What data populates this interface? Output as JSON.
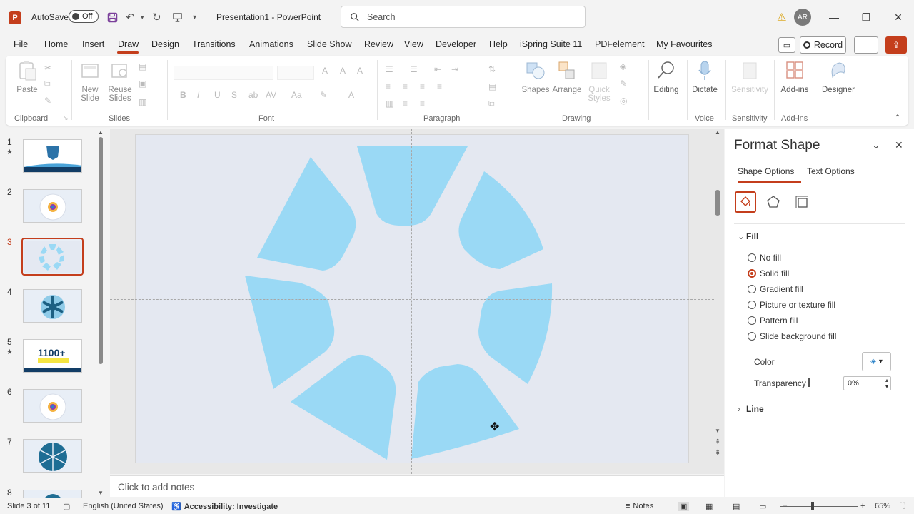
{
  "titlebar": {
    "autosave_label": "AutoSave",
    "autosave_state": "Off",
    "document_title": "Presentation1  -  PowerPoint",
    "search_placeholder": "Search",
    "avatar_initials": "AR",
    "minimize": "—",
    "restore": "❐",
    "close": "✕"
  },
  "menu": {
    "tabs": [
      "File",
      "Home",
      "Insert",
      "Draw",
      "Design",
      "Transitions",
      "Animations",
      "Slide Show",
      "Review",
      "View",
      "Developer",
      "Help",
      "iSpring Suite 11",
      "PDFelement",
      "My Favourites"
    ],
    "record_label": "Record"
  },
  "ribbon": {
    "paste": "Paste",
    "new_slide": "New",
    "new_slide2": "Slide",
    "reuse_slides": "Reuse",
    "reuse_slides2": "Slides",
    "shapes": "Shapes",
    "arrange": "Arrange",
    "quick_styles": "Quick",
    "quick_styles2": "Styles",
    "editing": "Editing",
    "dictate": "Dictate",
    "sensitivity": "Sensitivity",
    "addins": "Add-ins",
    "designer": "Designer",
    "groups": {
      "clipboard": "Clipboard",
      "slides": "Slides",
      "font": "Font",
      "paragraph": "Paragraph",
      "drawing": "Drawing",
      "voice": "Voice",
      "sensitivity": "Sensitivity",
      "addins": "Add-ins"
    }
  },
  "slides_panel": {
    "numbers": [
      "1",
      "2",
      "3",
      "4",
      "5",
      "6",
      "7",
      "8"
    ],
    "active_index": 3,
    "thumb5_text": "1100+"
  },
  "notes_placeholder": "Click to add notes",
  "format_pane": {
    "title": "Format Shape",
    "tabs": [
      "Shape Options",
      "Text Options"
    ],
    "fill_section": "Fill",
    "fill_options": [
      {
        "label": "No fill",
        "selected": false
      },
      {
        "label": "Solid fill",
        "selected": true
      },
      {
        "label": "Gradient fill",
        "selected": false
      },
      {
        "label": "Picture or texture fill",
        "selected": false
      },
      {
        "label": "Pattern fill",
        "selected": false
      },
      {
        "label": "Slide background fill",
        "selected": false
      }
    ],
    "color_label": "Color",
    "transparency_label": "Transparency",
    "transparency_value": "0%",
    "line_section": "Line"
  },
  "statusbar": {
    "slide_info": "Slide 3 of 11",
    "language": "English (United States)",
    "accessibility": "Accessibility: Investigate",
    "notes": "Notes",
    "zoom": "65%"
  },
  "colors": {
    "accent": "#c43e1c",
    "shape_fill": "#9ad9f5",
    "slide_bg": "#e4e8f1"
  }
}
